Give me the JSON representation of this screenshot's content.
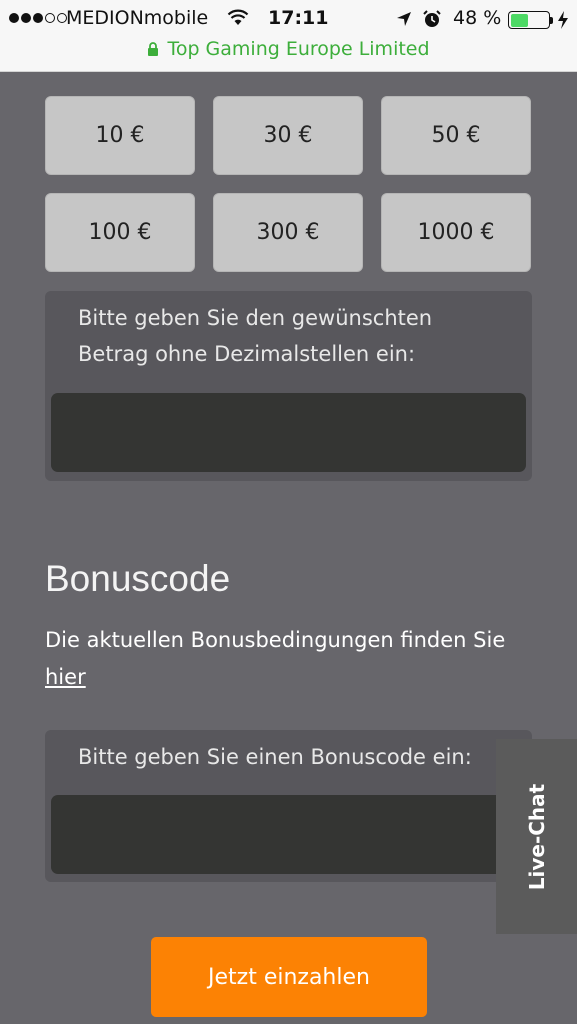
{
  "status_bar": {
    "carrier": "MEDIONmobile",
    "time": "17:11",
    "battery_percent": "48 %",
    "battery_level": 0.48,
    "url_title": "Top Gaming Europe Limited",
    "icons": [
      "signal-dots-icon",
      "wifi-icon",
      "location-arrow-icon",
      "alarm-clock-icon",
      "battery-icon",
      "charging-bolt-icon",
      "lock-icon"
    ]
  },
  "amounts": [
    "10 €",
    "30 €",
    "50 €",
    "100 €",
    "300 €",
    "1000 €"
  ],
  "custom_amount": {
    "label": "Bitte geben Sie den gewünschten Betrag ohne Dezimalstellen ein:",
    "value": ""
  },
  "bonus": {
    "heading": "Bonuscode",
    "info_text": "Die aktuellen Bonusbedingungen finden Sie ",
    "info_link": "hier",
    "input_label": "Bitte geben Sie einen Bonuscode ein:",
    "input_value": ""
  },
  "live_chat": {
    "label": "Live-Chat"
  },
  "submit": {
    "label": "Jetzt einzahlen"
  },
  "colors": {
    "accent": "#fc8204",
    "background": "#67666b",
    "panel": "#58575c",
    "input": "#343533",
    "secure_green": "#3dae3b"
  }
}
